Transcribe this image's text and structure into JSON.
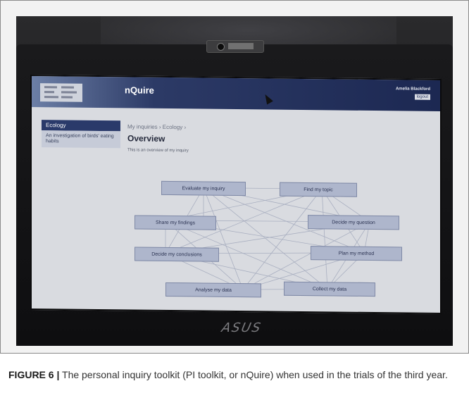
{
  "app": {
    "title": "nQuire",
    "user_name": "Amelia Blackford",
    "logout_label": "logout"
  },
  "sidebar": {
    "heading": "Ecology",
    "items": [
      {
        "label": "An investigation of birds' eating habits"
      }
    ]
  },
  "main": {
    "breadcrumb": "My inquiries › Ecology ›",
    "title": "Overview",
    "subtitle": "This is an overview of my inquiry"
  },
  "diagram": {
    "nodes": [
      {
        "id": "evaluate",
        "label": "Evaluate my inquiry"
      },
      {
        "id": "find-topic",
        "label": "Find my topic"
      },
      {
        "id": "share",
        "label": "Share my findings"
      },
      {
        "id": "decide-question",
        "label": "Decide my question"
      },
      {
        "id": "decide-conclusions",
        "label": "Decide my conclusions"
      },
      {
        "id": "plan-method",
        "label": "Plan my method"
      },
      {
        "id": "analyse",
        "label": "Analyse my data"
      },
      {
        "id": "collect",
        "label": "Collect my data"
      }
    ]
  },
  "laptop": {
    "brand": "ASUS"
  },
  "caption": {
    "label": "FIGURE 6 |",
    "text": " The personal inquiry toolkit (PI toolkit, or nQuire) when used in the trials of the third year."
  }
}
